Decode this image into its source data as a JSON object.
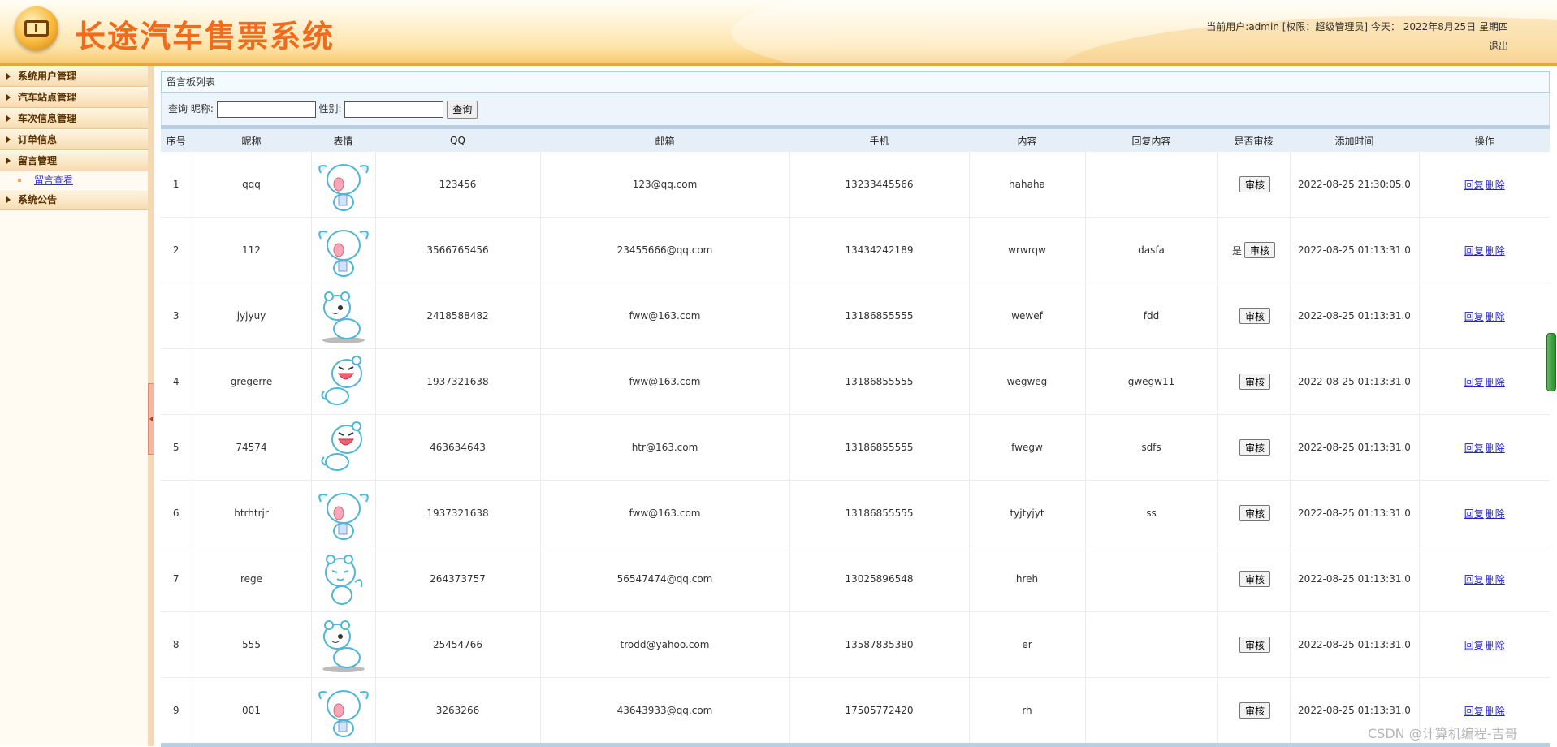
{
  "header": {
    "title": "长途汽车售票系统",
    "user_info": "当前用户:admin [权限：超级管理员] 今天： 2022年8月25日 星期四",
    "logout": "退出"
  },
  "sidebar": {
    "groups": [
      {
        "label": "系统用户管理"
      },
      {
        "label": "汽车站点管理"
      },
      {
        "label": "车次信息管理"
      },
      {
        "label": "订单信息"
      },
      {
        "label": "留言管理"
      },
      {
        "label": "系统公告"
      }
    ],
    "sub_item": "留言查看"
  },
  "panel": {
    "title": "留言板列表",
    "search_prefix": "查询 昵称:",
    "gender_label": "性别:",
    "search_button": "查询",
    "nickname_value": "",
    "gender_value": ""
  },
  "table": {
    "headers": [
      "序号",
      "昵称",
      "表情",
      "QQ",
      "邮箱",
      "手机",
      "内容",
      "回复内容",
      "是否审核",
      "添加时间",
      "操作"
    ],
    "audit_button": "审核",
    "reply_link": "回复",
    "delete_link": "删除",
    "rows": [
      {
        "no": "1",
        "nick": "qqq",
        "emo": "bear-holding-icon",
        "qq": "123456",
        "email": "123@qq.com",
        "phone": "13233445566",
        "content": "hahaha",
        "reply": "",
        "audited": "",
        "time": "2022-08-25 21:30:05.0"
      },
      {
        "no": "2",
        "nick": "112",
        "emo": "bear-holding-icon",
        "qq": "3566765456",
        "email": "23455666@qq.com",
        "phone": "13434242189",
        "content": "wrwrqw",
        "reply": "dasfa",
        "audited": "是",
        "time": "2022-08-25 01:13:31.0"
      },
      {
        "no": "3",
        "nick": "jyjyuy",
        "emo": "bear-sitting-icon",
        "qq": "2418588482",
        "email": "fww@163.com",
        "phone": "13186855555",
        "content": "wewef",
        "reply": "fdd",
        "audited": "",
        "time": "2022-08-25 01:13:31.0"
      },
      {
        "no": "4",
        "nick": "gregerre",
        "emo": "bear-laughing-icon",
        "qq": "1937321638",
        "email": "fww@163.com",
        "phone": "13186855555",
        "content": "wegweg",
        "reply": "gwegw11",
        "audited": "",
        "time": "2022-08-25 01:13:31.0"
      },
      {
        "no": "5",
        "nick": "74574",
        "emo": "bear-laughing-icon",
        "qq": "463634643",
        "email": "htr@163.com",
        "phone": "13186855555",
        "content": "fwegw",
        "reply": "sdfs",
        "audited": "",
        "time": "2022-08-25 01:13:31.0"
      },
      {
        "no": "6",
        "nick": "htrhtrjr",
        "emo": "bear-holding-icon",
        "qq": "1937321638",
        "email": "fww@163.com",
        "phone": "13186855555",
        "content": "tyjtyjyt",
        "reply": "ss",
        "audited": "",
        "time": "2022-08-25 01:13:31.0"
      },
      {
        "no": "7",
        "nick": "rege",
        "emo": "bear-waving-icon",
        "qq": "264373757",
        "email": "56547474@qq.com",
        "phone": "13025896548",
        "content": "hreh",
        "reply": "",
        "audited": "",
        "time": "2022-08-25 01:13:31.0"
      },
      {
        "no": "8",
        "nick": "555",
        "emo": "bear-sitting-icon",
        "qq": "25454766",
        "email": "trodd@yahoo.com",
        "phone": "13587835380",
        "content": "er",
        "reply": "",
        "audited": "",
        "time": "2022-08-25 01:13:31.0"
      },
      {
        "no": "9",
        "nick": "001",
        "emo": "bear-holding-icon",
        "qq": "3263266",
        "email": "43643933@qq.com",
        "phone": "17505772420",
        "content": "rh",
        "reply": "",
        "audited": "",
        "time": "2022-08-25 01:13:31.0"
      }
    ]
  },
  "watermark": "CSDN @计算机编程-吉哥"
}
